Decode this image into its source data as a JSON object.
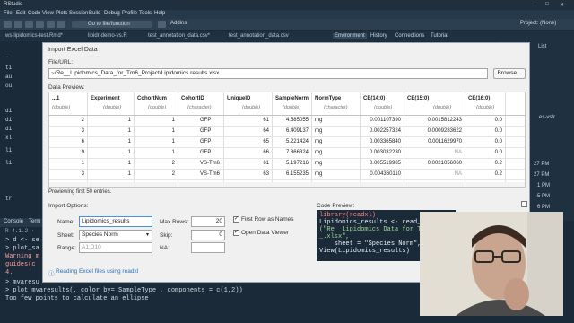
{
  "window_title": "RStudio",
  "window_project": "Project: (None)",
  "menu": [
    "File",
    "Edit",
    "Code",
    "View",
    "Plots",
    "Session",
    "Build",
    "Debug",
    "Profile",
    "Tools",
    "Help"
  ],
  "toolbar": {
    "go_to_label": "Go to file/function",
    "addins_label": "Addins"
  },
  "editor_tabs": [
    "ws-lipidomics-test.Rmd*",
    "lipidr-demo-vs.R",
    "test_annotation_data.csv*",
    "test_annotation_data.csv"
  ],
  "env_tabs": [
    "Environment",
    "History",
    "Connections",
    "Tutorial"
  ],
  "right_panel": {
    "list_label": "List",
    "path_text": "es-vs/r",
    "times": [
      "27 PM",
      "27 PM",
      "1 PM",
      "5 PM",
      "6 PM"
    ]
  },
  "editor_lines": [
    "–",
    "ti",
    "au",
    "ou",
    "",
    "",
    "di",
    "di",
    "di",
    "xl",
    "",
    "li",
    "",
    "li",
    "",
    "tr"
  ],
  "console": {
    "tabs": [
      "Console",
      "Term"
    ],
    "r_version": "R 4.1.2 ·",
    "lines": [
      "> d <- se",
      "> plot_sa",
      "Warning m",
      "  guides(c",
      "4.",
      "> mvaresu",
      "> plot_mvaresults(, color_by= SampleType , components = c(1,2))",
      "Too few points to calculate an ellipse"
    ]
  },
  "dialog": {
    "title": "Import Excel Data",
    "file_url_label": "File/URL:",
    "file_url_value": "~/Re__Lipidomics_Data_for_Tm6_Project/Lipidomics results.xlsx",
    "browse_label": "Browse...",
    "data_preview_label": "Data Preview:",
    "columns": [
      {
        "name": "...1",
        "type": "(double)"
      },
      {
        "name": "Experiment",
        "type": "(double)"
      },
      {
        "name": "CohortNum",
        "type": "(double)"
      },
      {
        "name": "CohortID",
        "type": "(character)"
      },
      {
        "name": "UniqueID",
        "type": "(double)"
      },
      {
        "name": "SampleNorm",
        "type": "(double)"
      },
      {
        "name": "NormType",
        "type": "(character)"
      },
      {
        "name": "CE(14:0)",
        "type": "(double)"
      },
      {
        "name": "CE(15:0)",
        "type": "(double)"
      },
      {
        "name": "CE(16:0)",
        "type": "(double)"
      }
    ],
    "rows": [
      [
        "2",
        "1",
        "1",
        "GFP",
        "61",
        "4.585055",
        "mg",
        "0.001107390",
        "0.0015812243",
        "0.0"
      ],
      [
        "3",
        "1",
        "1",
        "GFP",
        "64",
        "6.409137",
        "mg",
        "0.002257324",
        "0.0009283622",
        "0.0"
      ],
      [
        "6",
        "1",
        "1",
        "GFP",
        "65",
        "5.221424",
        "mg",
        "0.003365840",
        "0.0011629970",
        "0.0"
      ],
      [
        "9",
        "1",
        "1",
        "GFP",
        "66",
        "7.866324",
        "mg",
        "0.003032230",
        "NA",
        "0.0"
      ],
      [
        "1",
        "1",
        "2",
        "VS-Tm6",
        "61",
        "5.197216",
        "mg",
        "0.005519985",
        "0.0021056060",
        "0.2"
      ],
      [
        "3",
        "1",
        "2",
        "VS-Tm6",
        "63",
        "6.155235",
        "mg",
        "0.004360110",
        "NA",
        "0.2"
      ]
    ],
    "preview_note": "Previewing first 50 entries.",
    "import_options_label": "Import Options:",
    "name_label": "Name:",
    "name_value": "Lipidomics_results",
    "sheet_label": "Sheet:",
    "sheet_value": "Species Norm",
    "range_label": "Range:",
    "range_placeholder": "A1:D10",
    "max_rows_label": "Max Rows:",
    "max_rows_value": "20",
    "skip_label": "Skip:",
    "skip_value": "0",
    "na_label": "NA:",
    "na_value": "",
    "first_row_label": "First Row as Names",
    "open_viewer_label": "Open Data Viewer",
    "help_link": "Reading Excel files using readxl",
    "code_preview_label": "Code Preview:",
    "code_lines": [
      "library(readxl)",
      "Lipidomics_results <- read_e",
      "(\"Re__Lipidomics_Data_for_Tm6",
      "_.xlsx\",",
      "    sheet = \"Species Norm\",",
      "View(Lipidomics_results)"
    ]
  }
}
